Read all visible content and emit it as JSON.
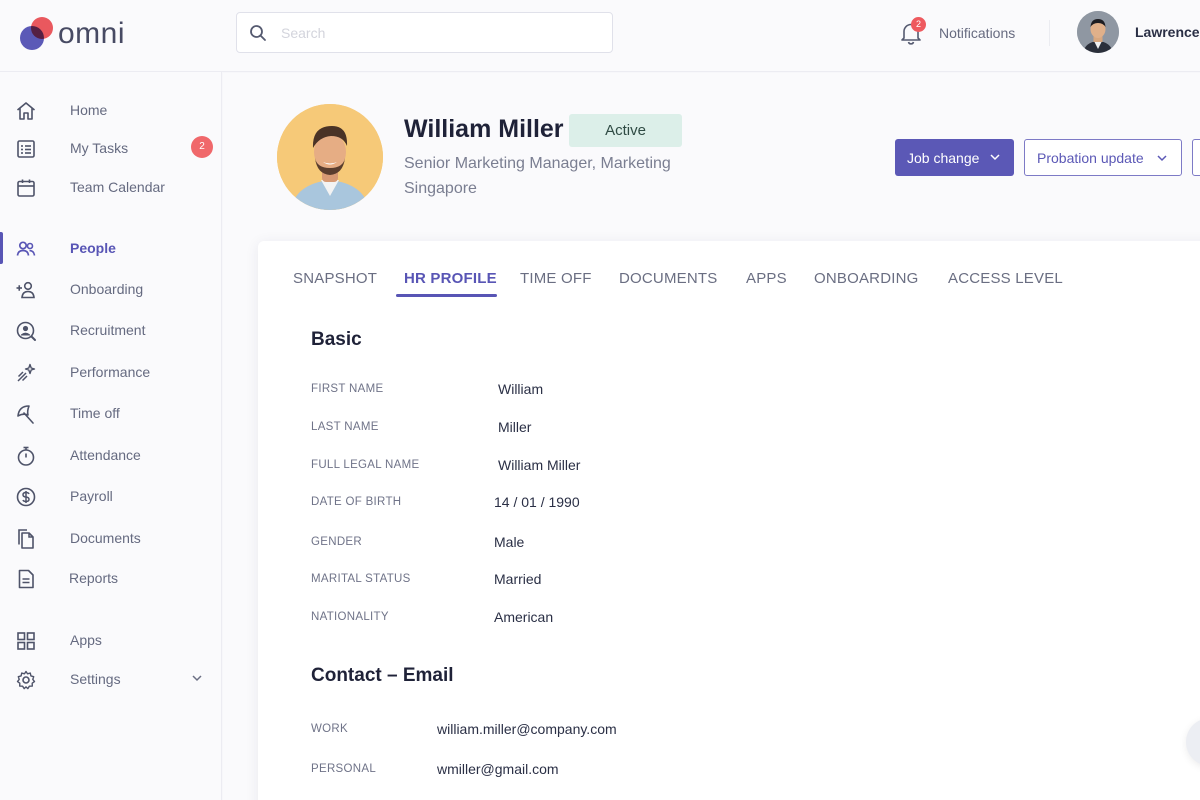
{
  "app": {
    "name": "omni"
  },
  "search": {
    "placeholder": "Search"
  },
  "notifications": {
    "count": "2",
    "label": "Notifications"
  },
  "user": {
    "name": "Lawrence"
  },
  "sidebar": {
    "items": [
      {
        "label": "Home",
        "icon": "home-icon"
      },
      {
        "label": "My Tasks",
        "icon": "tasks-icon",
        "badge": "2"
      },
      {
        "label": "Team Calendar",
        "icon": "calendar-icon"
      },
      {
        "label": "People",
        "icon": "people-icon",
        "active": true
      },
      {
        "label": "Onboarding",
        "icon": "add-user-icon"
      },
      {
        "label": "Recruitment",
        "icon": "recruitment-icon"
      },
      {
        "label": "Performance",
        "icon": "sparkle-icon"
      },
      {
        "label": "Time off",
        "icon": "umbrella-icon"
      },
      {
        "label": "Attendance",
        "icon": "stopwatch-icon"
      },
      {
        "label": "Payroll",
        "icon": "dollar-icon"
      },
      {
        "label": "Documents",
        "icon": "documents-icon"
      },
      {
        "label": "Reports",
        "icon": "report-icon"
      },
      {
        "label": "Apps",
        "icon": "apps-icon"
      },
      {
        "label": "Settings",
        "icon": "gear-icon"
      }
    ]
  },
  "profile": {
    "name": "William Miller",
    "status": "Active",
    "title": "Senior Marketing Manager, Marketing",
    "location": "Singapore",
    "actions": {
      "job_change": "Job change",
      "probation_update": "Probation update"
    }
  },
  "tabs": [
    {
      "label": "SNAPSHOT"
    },
    {
      "label": "HR PROFILE",
      "active": true
    },
    {
      "label": "TIME OFF"
    },
    {
      "label": "DOCUMENTS"
    },
    {
      "label": "APPS"
    },
    {
      "label": "ONBOARDING"
    },
    {
      "label": "ACCESS LEVEL"
    }
  ],
  "basic": {
    "title": "Basic",
    "fields": [
      {
        "label": "FIRST NAME",
        "value": "William"
      },
      {
        "label": "LAST NAME",
        "value": "Miller"
      },
      {
        "label": "FULL LEGAL NAME",
        "value": "William Miller"
      },
      {
        "label": "DATE OF BIRTH",
        "value": "14 / 01 / 1990"
      },
      {
        "label": "GENDER",
        "value": "Male"
      },
      {
        "label": "MARITAL STATUS",
        "value": "Married"
      },
      {
        "label": "NATIONALITY",
        "value": "American"
      }
    ]
  },
  "contact_email": {
    "title": "Contact – Email",
    "fields": [
      {
        "label": "WORK",
        "value": "william.miller@company.com"
      },
      {
        "label": "PERSONAL",
        "value": "wmiller@gmail.com"
      }
    ]
  },
  "colors": {
    "brand_primary": "#5b58b6",
    "brand_accent": "#ee5a5f",
    "status_active_bg": "#dcefe9"
  }
}
